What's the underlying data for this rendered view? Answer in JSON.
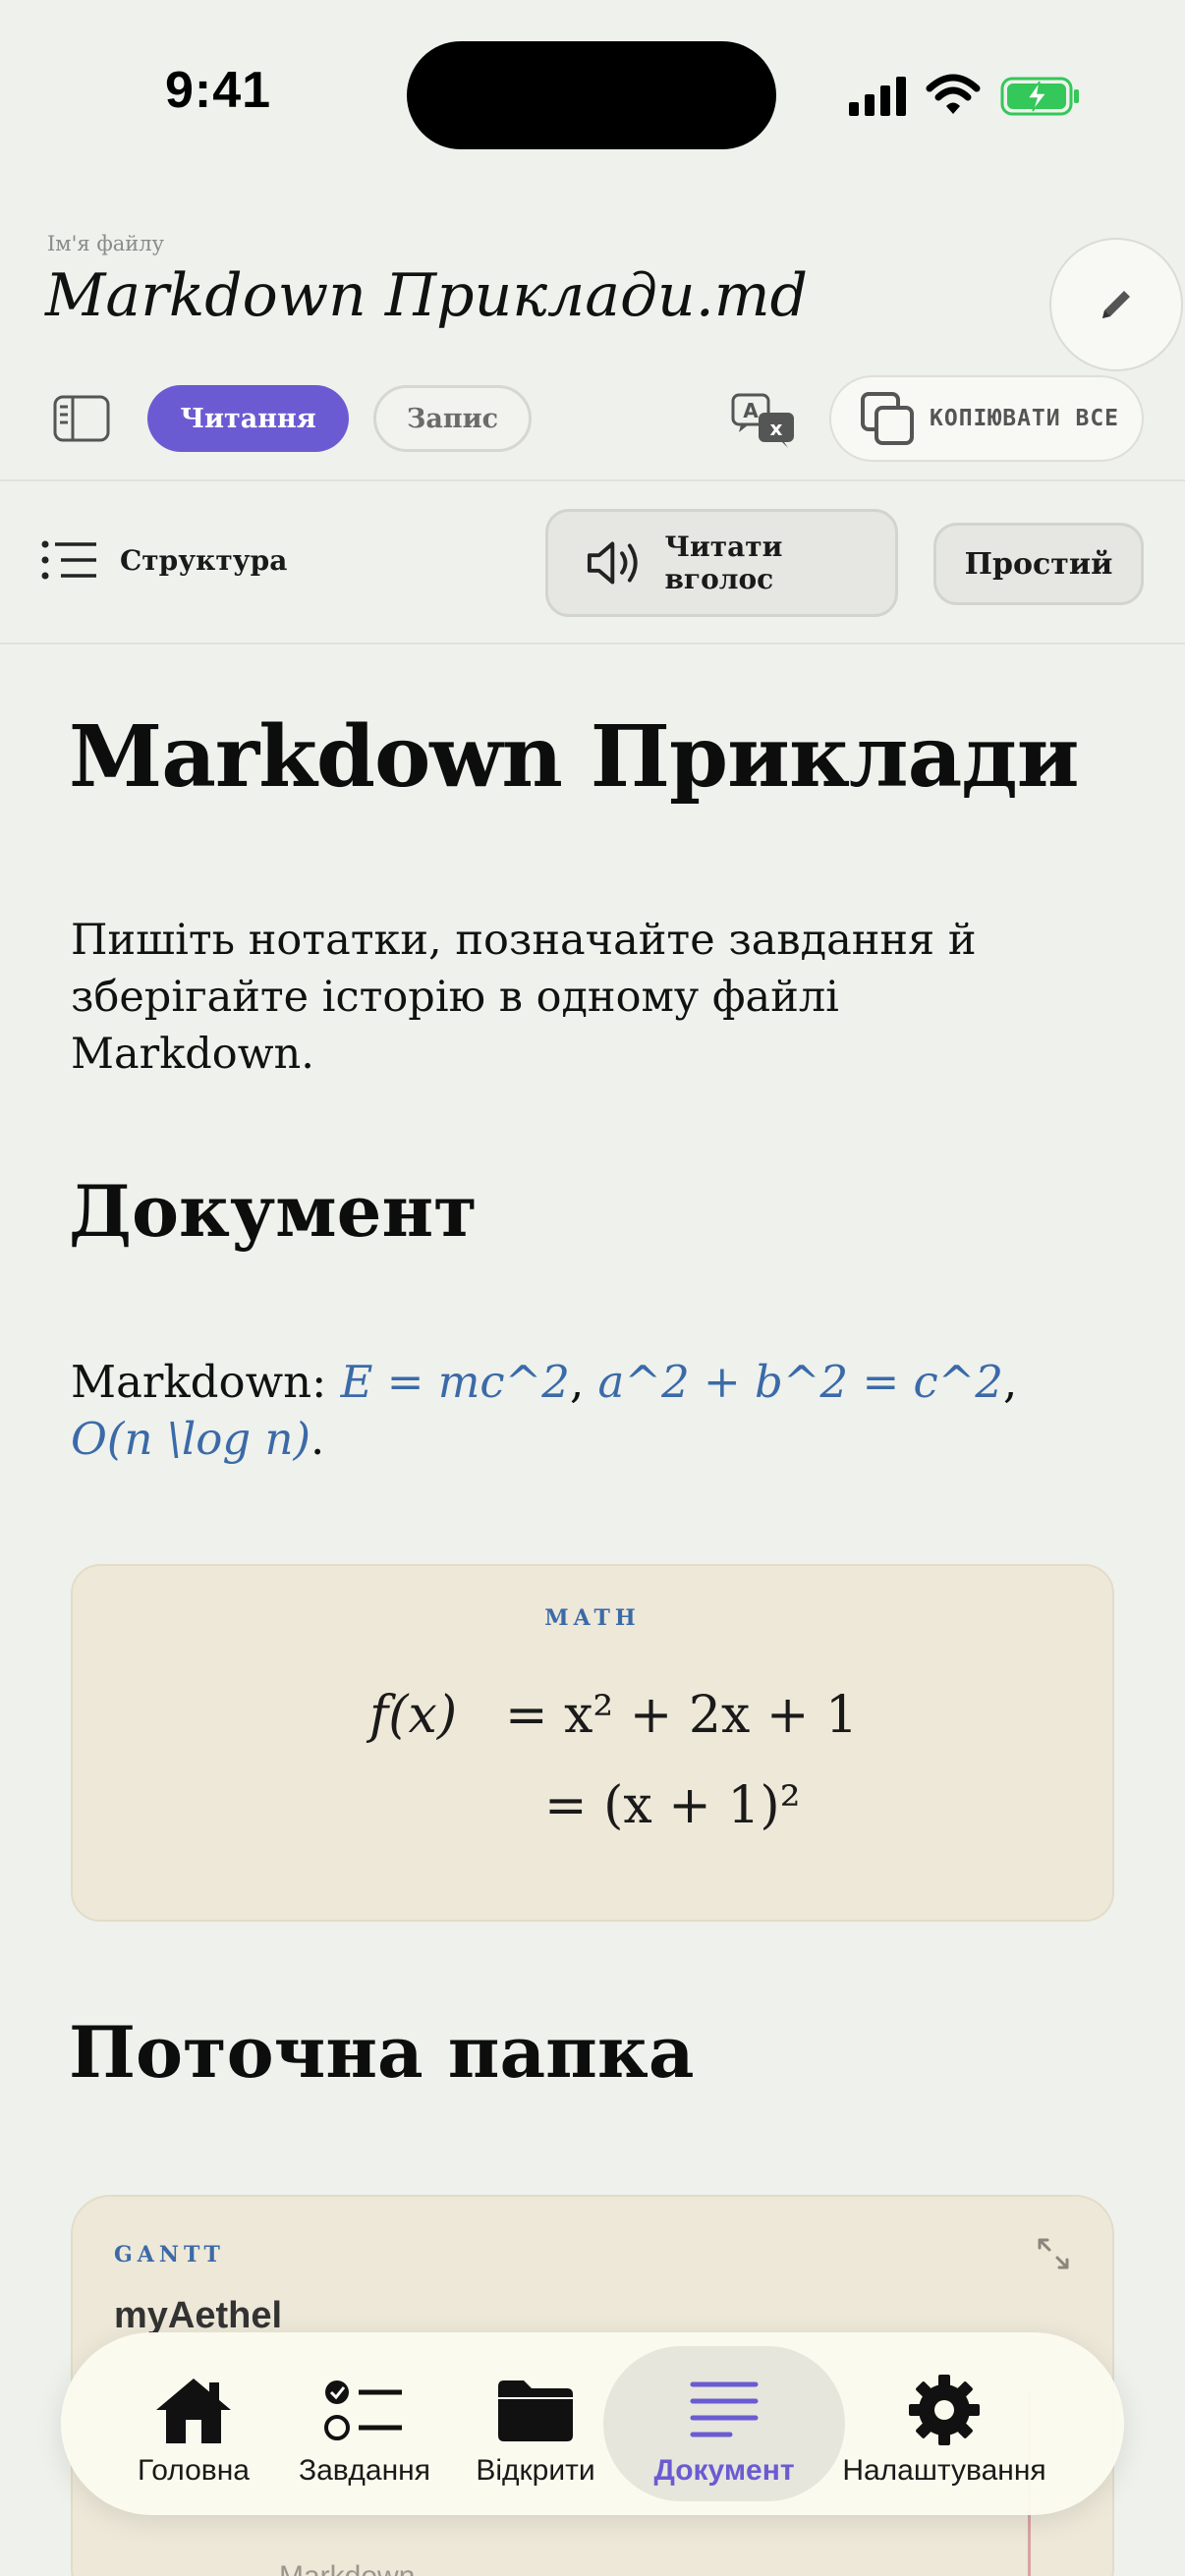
{
  "status_bar": {
    "time": "9:41"
  },
  "header": {
    "file_name_label": "Ім'я файлу",
    "file_name": "Markdown Приклади.md"
  },
  "toolbar": {
    "mode_read": "Читання",
    "mode_write": "Запис",
    "copy_all": "КОПІЮВАТИ ВСЕ",
    "outline": "Структура",
    "read_aloud": "Читати вголос",
    "simple": "Простий"
  },
  "document": {
    "title": "Markdown Приклади",
    "intro": "Пишіть нотатки, позначайте завдання й зберігайте історію в одному файлі Markdown.",
    "section_document": "Документ",
    "math_prefix": "Markdown: ",
    "math_inline_1": "E = mc^2",
    "math_inline_2": "a^2 + b^2 = c^2",
    "math_inline_3": "O(n \\log n)",
    "math_sep": ", ",
    "math_end": ".",
    "math_block": {
      "tag": "MATH",
      "line1_lhs": "f(x)",
      "line1_rhs": "= x² + 2x + 1",
      "line2_rhs": "= (x + 1)²"
    },
    "section_folder": "Поточна папка",
    "gantt": {
      "tag": "GANTT",
      "title": "myAethel",
      "row_label": "Markdown"
    }
  },
  "tab_bar": {
    "items": [
      {
        "label": "Головна",
        "icon": "home-icon"
      },
      {
        "label": "Завдання",
        "icon": "checklist-icon"
      },
      {
        "label": "Відкрити",
        "icon": "folder-icon"
      },
      {
        "label": "Документ",
        "icon": "document-lines-icon",
        "active": true
      },
      {
        "label": "Налаштування",
        "icon": "gear-icon"
      }
    ]
  },
  "colors": {
    "accent": "#6b5bd2",
    "link_math": "#3b6aa8",
    "background": "#eef1ec",
    "card": "#ede8d8",
    "battery": "#34c759"
  }
}
